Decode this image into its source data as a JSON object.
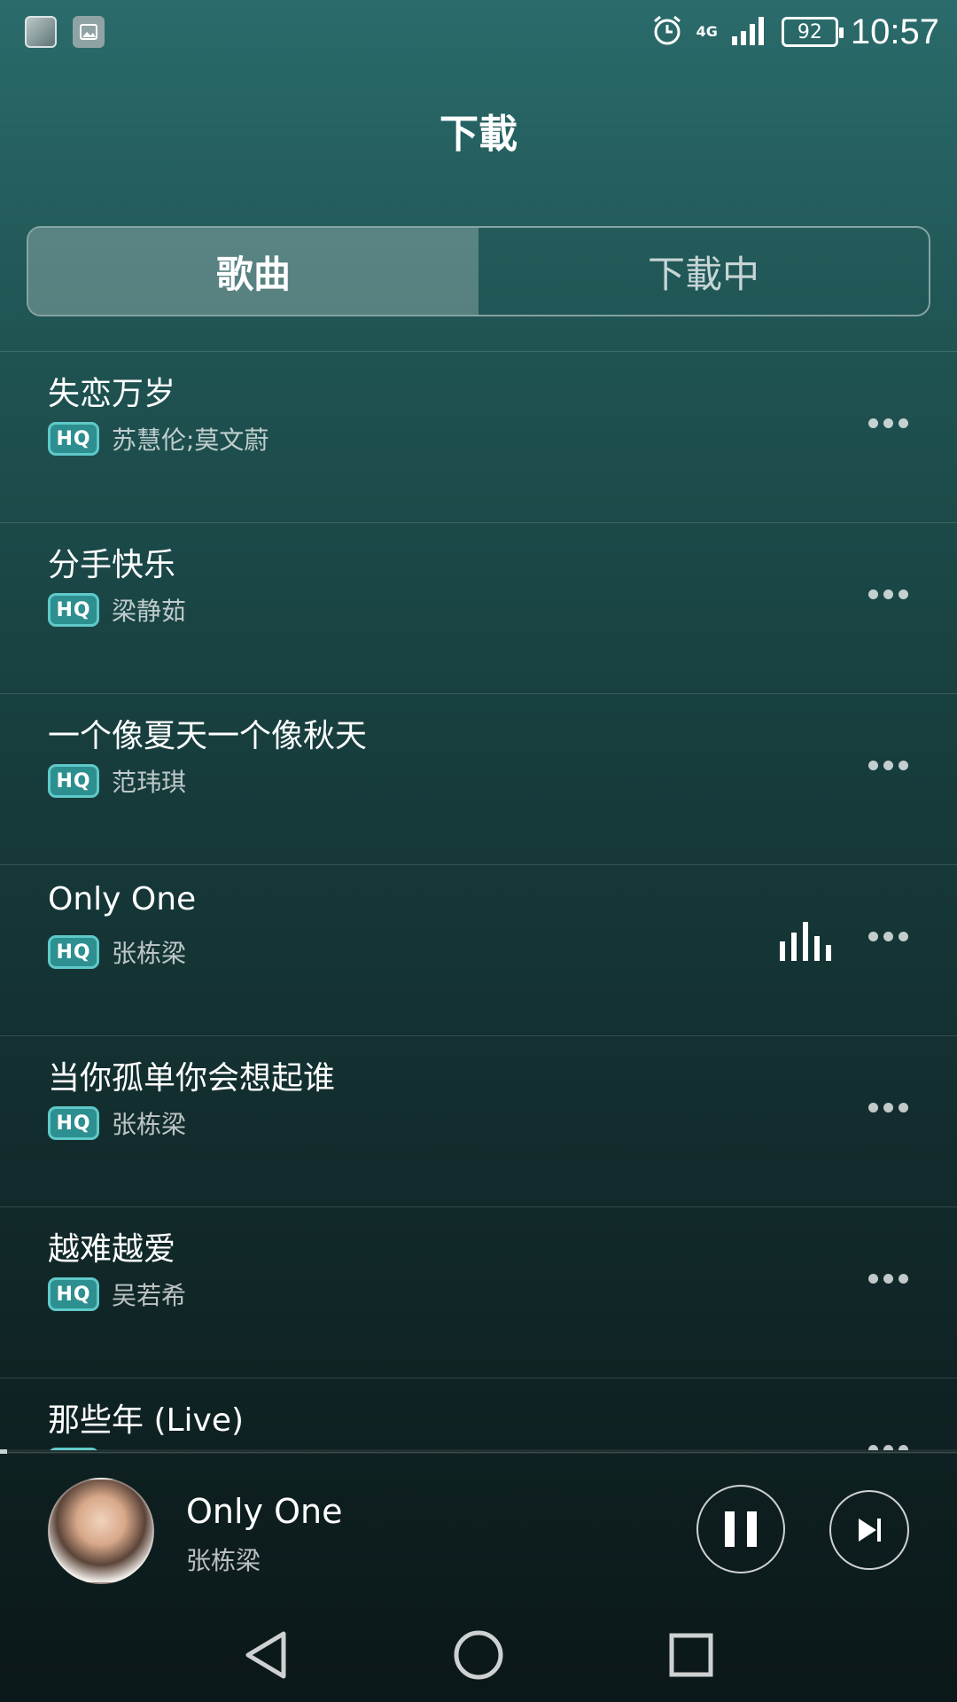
{
  "status_bar": {
    "time": "10:57",
    "battery": "92",
    "network": "4G",
    "icons": [
      "avatar-thumb",
      "gallery-icon",
      "alarm-icon",
      "signal-icon",
      "battery-icon"
    ]
  },
  "header": {
    "title": "下載"
  },
  "tabs": [
    {
      "label": "歌曲",
      "active": true
    },
    {
      "label": "下載中",
      "active": false
    }
  ],
  "songs": [
    {
      "title": "失恋万岁",
      "artist": "苏慧伦;莫文蔚",
      "badge": "HQ",
      "playing": false
    },
    {
      "title": "分手快乐",
      "artist": "梁静茹",
      "badge": "HQ",
      "playing": false
    },
    {
      "title": "一个像夏天一个像秋天",
      "artist": "范玮琪",
      "badge": "HQ",
      "playing": false
    },
    {
      "title": "Only One",
      "artist": "张栋梁",
      "badge": "HQ",
      "playing": true
    },
    {
      "title": "当你孤单你会想起谁",
      "artist": "张栋梁",
      "badge": "HQ",
      "playing": false
    },
    {
      "title": "越难越爱",
      "artist": "吴若希",
      "badge": "HQ",
      "playing": false
    },
    {
      "title": "那些年 (Live)",
      "artist": "",
      "badge": "HQ",
      "playing": false
    }
  ],
  "now_playing": {
    "title": "Only One",
    "artist": "张栋梁",
    "progress": 0.007
  },
  "colors": {
    "accent": "#2d8f8f",
    "badge_border": "#5fc9c9"
  }
}
